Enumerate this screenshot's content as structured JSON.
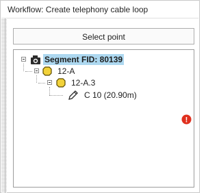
{
  "window": {
    "title": "Workflow: Create telephony cable loop"
  },
  "toolbar": {
    "select_point_label": "Select point"
  },
  "tree": {
    "root": {
      "label": "Segment FID: 80139",
      "icon": "camera-segment-icon",
      "expanded": true,
      "selected": true
    },
    "level1": {
      "label": "12-A",
      "icon": "yellow-node-icon",
      "expanded": true
    },
    "level2": {
      "label": "12-A.3",
      "icon": "yellow-node-icon",
      "expanded": true
    },
    "level3": {
      "label": "C 10 (20.90m)",
      "icon": "pencil-icon"
    }
  },
  "status": {
    "error_icon": "error-icon",
    "error_glyph": "!",
    "error_color": "#e0301e"
  },
  "colors": {
    "selection": "#add8f0",
    "node_yellow": "#f2d23a",
    "border": "#9c9c9c"
  }
}
